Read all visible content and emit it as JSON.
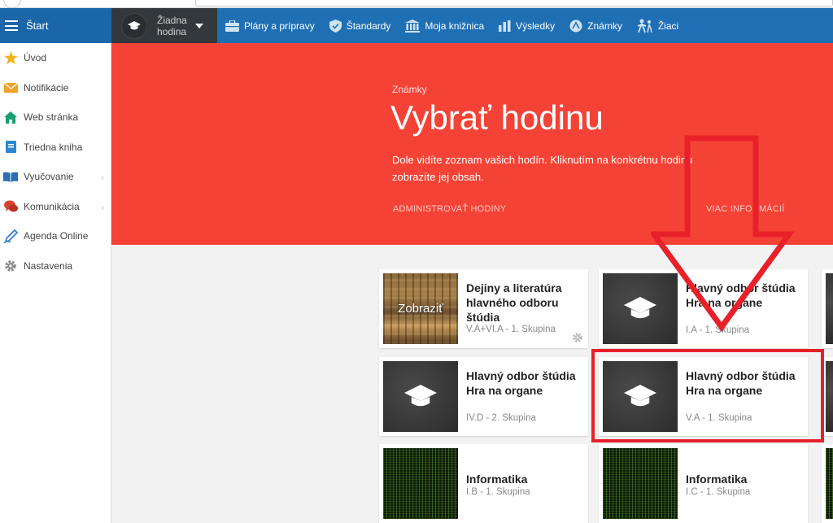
{
  "nav": {
    "start_label": "Štart",
    "no_hour_line1": "Žiadna",
    "no_hour_line2": "hodina",
    "items": [
      {
        "label": "Plány a prípravy",
        "icon": "briefcase-icon"
      },
      {
        "label": "Štandardy",
        "icon": "shield-icon"
      },
      {
        "label": "Moja knižnica",
        "icon": "library-icon"
      },
      {
        "label": "Výsledky",
        "icon": "bar-chart-icon"
      },
      {
        "label": "Známky",
        "icon": "grades-icon"
      },
      {
        "label": "Žiaci",
        "icon": "students-icon"
      }
    ]
  },
  "sidebar": {
    "items": [
      {
        "label": "Úvod",
        "icon": "star-icon"
      },
      {
        "label": "Notifikácie",
        "icon": "envelope-icon"
      },
      {
        "label": "Web stránka",
        "icon": "home-icon"
      },
      {
        "label": "Triedna kniha",
        "icon": "book-icon"
      },
      {
        "label": "Vyučovanie",
        "icon": "open-book-icon",
        "has_submenu": true
      },
      {
        "label": "Komunikácia",
        "icon": "chat-icon",
        "has_submenu": true
      },
      {
        "label": "Agenda Online",
        "icon": "pen-icon"
      },
      {
        "label": "Nastavenia",
        "icon": "gear-icon"
      }
    ]
  },
  "hero": {
    "crumb": "Známky",
    "title": "Vybrať hodinu",
    "description": "Dole vidíte zoznam vašich hodín. Kliknutím na konkrétnu hodinu zobrazíte jej obsah.",
    "admin_link": "ADMINISTROVAŤ HODINY",
    "more_link": "VIAC INFORMÁCIÍ"
  },
  "cards": [
    {
      "title": "Dejiny a literatúra hlavného odboru štúdia",
      "subtitle": "V.A+VI.A - 1. Skupina",
      "thumb": "egypt",
      "overlay": "Zobraziť"
    },
    {
      "title": "Hlavný odbor štúdia Hra na organe",
      "subtitle": "I.A - 1. Skupina",
      "thumb": "chalk"
    },
    {
      "title": "Hlavný odbor štúdia Hra na organe",
      "subtitle": "IV.D - 2. Skupina",
      "thumb": "chalk"
    },
    {
      "title": "Hlavný odbor štúdia Hra na organe",
      "subtitle": "V.A - 1. Skupina",
      "thumb": "chalk"
    },
    {
      "title": "Informatika",
      "subtitle": "I.B - 1. Skupina",
      "thumb": "matrix"
    },
    {
      "title": "Informatika",
      "subtitle": "I.C - 1. Skupina",
      "thumb": "matrix"
    }
  ],
  "colors": {
    "nav_blue": "#1f6fb4",
    "hero_red": "#f44336",
    "annotation_red": "#e8202a"
  }
}
